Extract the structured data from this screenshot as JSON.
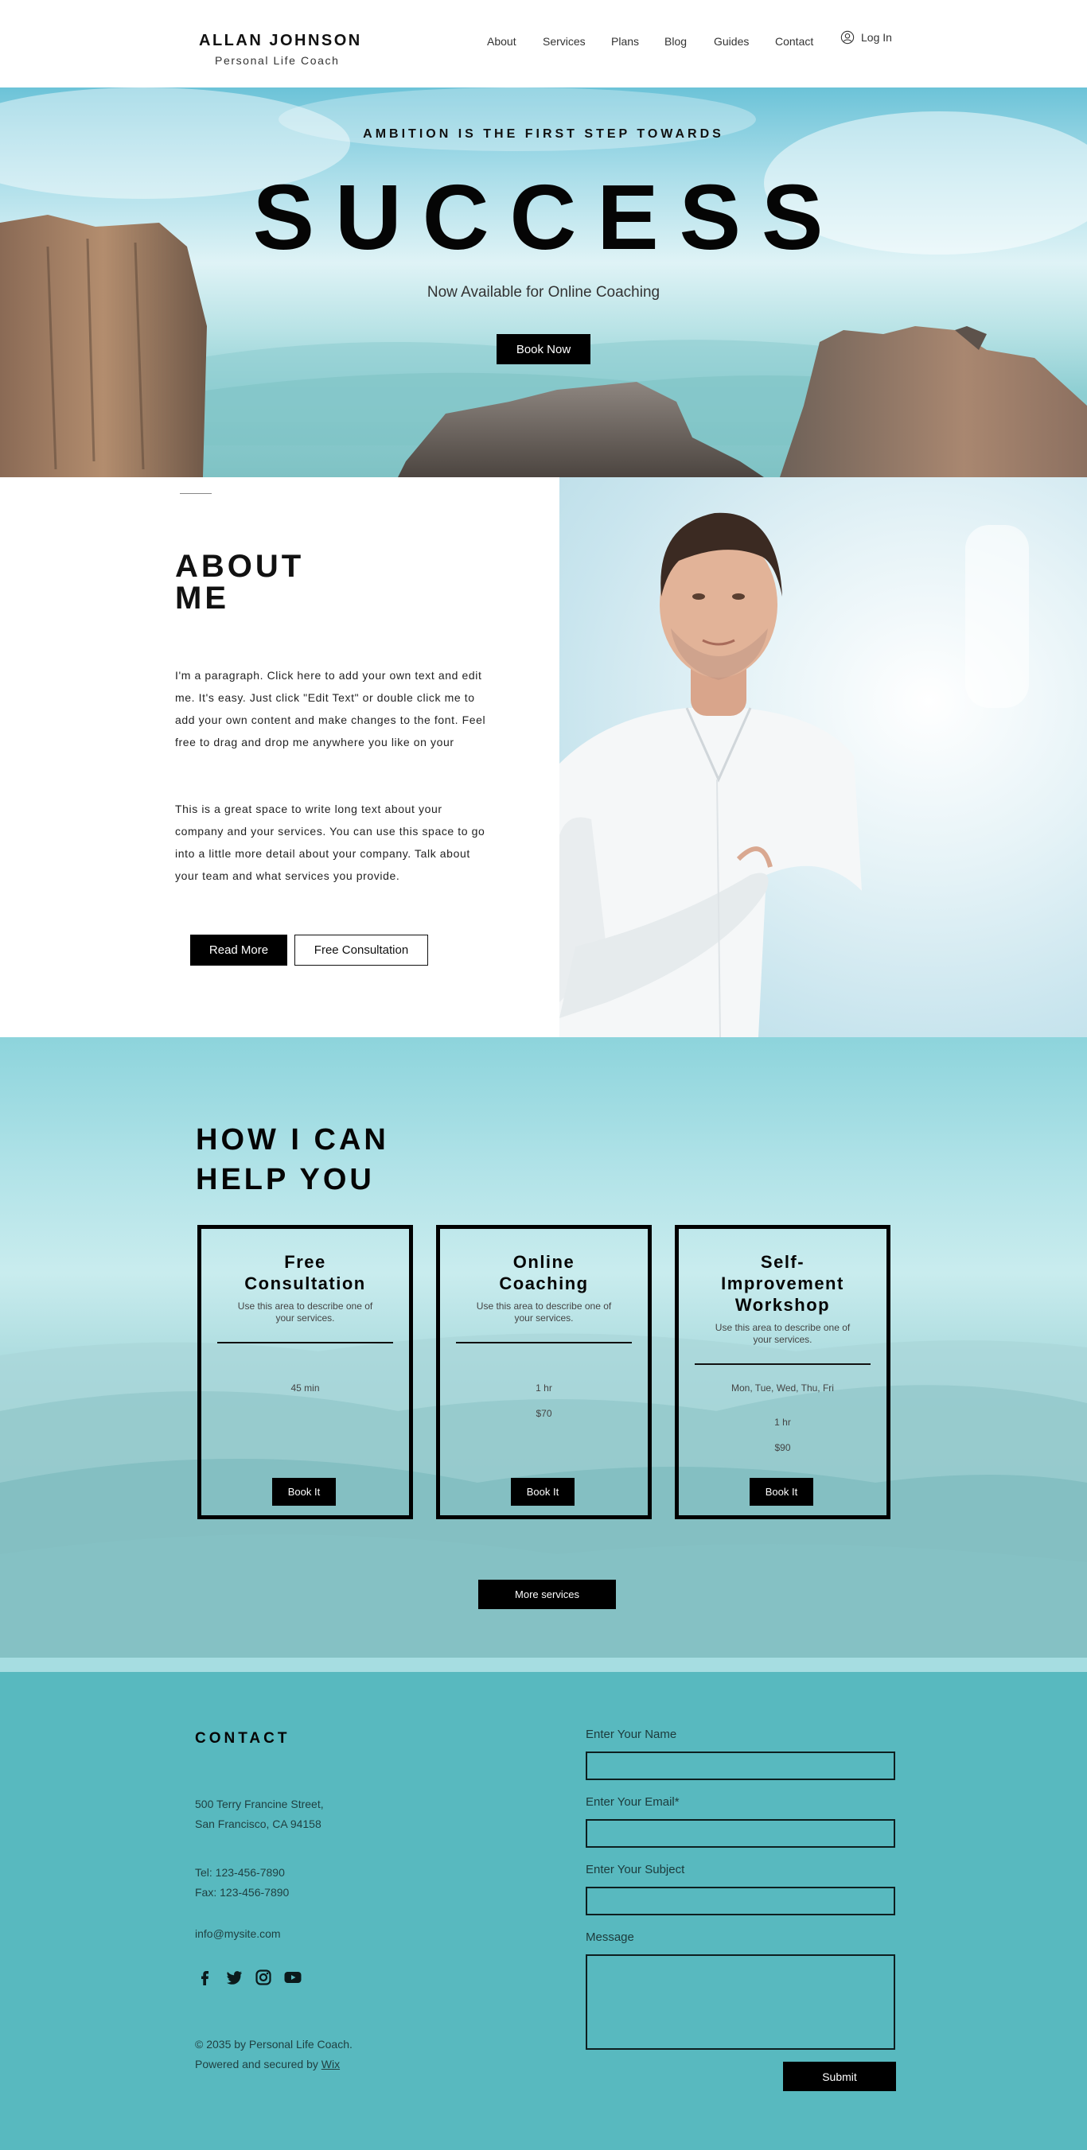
{
  "header": {
    "brand_name": "ALLAN JOHNSON",
    "brand_subtitle": "Personal Life Coach",
    "nav": [
      "About",
      "Services",
      "Plans",
      "Blog",
      "Guides",
      "Contact"
    ],
    "login_label": "Log In",
    "login_icon": "user-circle-icon"
  },
  "hero": {
    "tagline": "AMBITION IS THE FIRST STEP TOWARDS",
    "title": "SUCCESS",
    "subtitle": "Now Available for Online Coaching",
    "cta_label": "Book Now"
  },
  "about": {
    "title_line1": "ABOUT",
    "title_line2": "ME",
    "paragraph1": "I'm a paragraph. Click here to add your own text and edit me. It's easy. Just click \"Edit Text\" or double click me to add your own content and make changes to the font. Feel free to drag and drop me anywhere you like on your",
    "paragraph2": "This is a great space to write long text about your company and your services. You can use this space to go into a little more detail about your company. Talk about your team and what services you provide.",
    "read_more_label": "Read More",
    "consultation_label": "Free Consultation"
  },
  "services": {
    "title_line1": "HOW I CAN",
    "title_line2": "HELP YOU",
    "cards": [
      {
        "title": [
          "Free",
          "Consultation"
        ],
        "description": "Use this area to describe one of your services.",
        "details": [
          "45 min"
        ],
        "button": "Book It"
      },
      {
        "title": [
          "Online",
          "Coaching"
        ],
        "description": "Use this area to describe one of your services.",
        "details": [
          "1 hr",
          "$70"
        ],
        "button": "Book It"
      },
      {
        "title": [
          "Self-",
          "Improvement",
          "Workshop"
        ],
        "description": "Use this area to describe one of your services.",
        "details": [
          "Mon, Tue, Wed, Thu, Fri",
          "1 hr",
          "$90"
        ],
        "button": "Book It"
      }
    ],
    "more_label": "More services"
  },
  "contact": {
    "title": "CONTACT",
    "address_line1": "500 Terry Francine Street,",
    "address_line2": "San Francisco, CA 94158",
    "tel": "Tel: 123-456-7890",
    "fax": "Fax: 123-456-7890",
    "email": "info@mysite.com",
    "social_icons": [
      "facebook-icon",
      "twitter-icon",
      "instagram-icon",
      "youtube-icon"
    ],
    "copyright": "© 2035 by Personal Life Coach.",
    "powered_prefix": "Powered and secured by",
    "powered_link": "Wix",
    "form": {
      "name_label": "Enter Your Name",
      "email_label": "Enter Your Email*",
      "subject_label": "Enter Your Subject",
      "message_label": "Message",
      "submit_label": "Submit"
    }
  },
  "colors": {
    "contact_bg": "#58b9bf",
    "button_dark": "#000000",
    "text_dark": "#111111"
  }
}
